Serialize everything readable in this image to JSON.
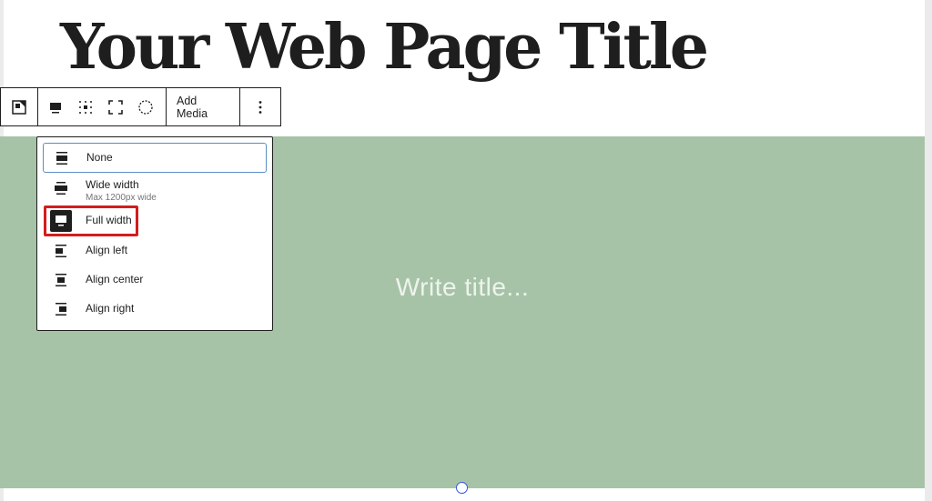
{
  "page": {
    "title": "Your Web Page Title"
  },
  "cover": {
    "title_placeholder": "Write title...",
    "background_color": "#a7c3a7"
  },
  "toolbar": {
    "add_media_label": "Add Media",
    "buttons": [
      "cover-block-icon",
      "align-icon",
      "focal-point-icon",
      "fullscreen-icon",
      "duotone-icon",
      "more-options-icon"
    ]
  },
  "alignment_menu": {
    "items": [
      {
        "label": "None",
        "icon": "align-none-icon"
      },
      {
        "label": "Wide width",
        "sublabel": "Max 1200px wide",
        "icon": "align-wide-icon"
      },
      {
        "label": "Full width",
        "icon": "align-full-icon"
      },
      {
        "label": "Align left",
        "icon": "align-left-icon"
      },
      {
        "label": "Align center",
        "icon": "align-center-icon"
      },
      {
        "label": "Align right",
        "icon": "align-right-icon"
      }
    ],
    "selected": "Full width",
    "highlight_color": "#d31d1d"
  }
}
